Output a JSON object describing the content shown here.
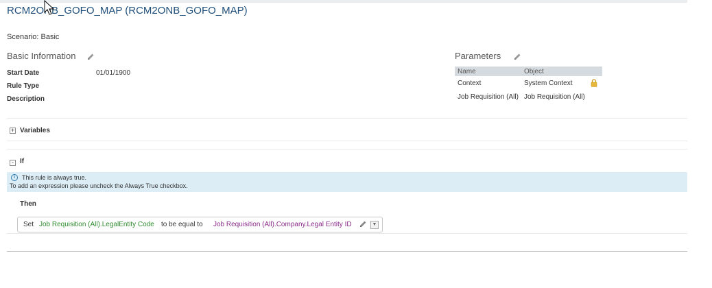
{
  "header": {
    "title": "RCM2ONB_GOFO_MAP (RCM2ONB_GOFO_MAP)",
    "scenario": "Scenario: Basic"
  },
  "basic_info": {
    "heading": "Basic Information",
    "fields": [
      {
        "label": "Start Date",
        "value": "01/01/1900"
      },
      {
        "label": "Rule Type",
        "value": ""
      },
      {
        "label": "Description",
        "value": ""
      }
    ]
  },
  "parameters": {
    "heading": "Parameters",
    "columns": [
      "Name",
      "Object"
    ],
    "rows": [
      {
        "name": "Context",
        "object": "System Context",
        "locked": true
      },
      {
        "name": "Job Requisition (All)",
        "object": "Job Requisition (All)",
        "locked": false
      }
    ]
  },
  "variables": {
    "label": "Variables",
    "expander": "+"
  },
  "if_section": {
    "label": "If",
    "expander": "-",
    "info_icon": "i",
    "info_line1": "This rule is always true.",
    "info_line2": "To add an expression please uncheck the Always True checkbox."
  },
  "then_section": {
    "label": "Then",
    "expression": {
      "set": "Set",
      "target": "Job Requisition (All).LegalEntity Code",
      "operator": "to be equal to",
      "source": "Job Requisition (All).Company.Legal Entity ID",
      "dropdown_glyph": "▼"
    }
  },
  "colors": {
    "title": "#1f4f7a",
    "green": "#2f8a2f",
    "purple": "#8a2a8a",
    "info_bg": "#dcedf5"
  },
  "icons": [
    "pencil-icon",
    "lock-icon",
    "info-icon",
    "expand-icon",
    "collapse-icon",
    "dropdown-icon",
    "mouse-cursor-icon"
  ]
}
